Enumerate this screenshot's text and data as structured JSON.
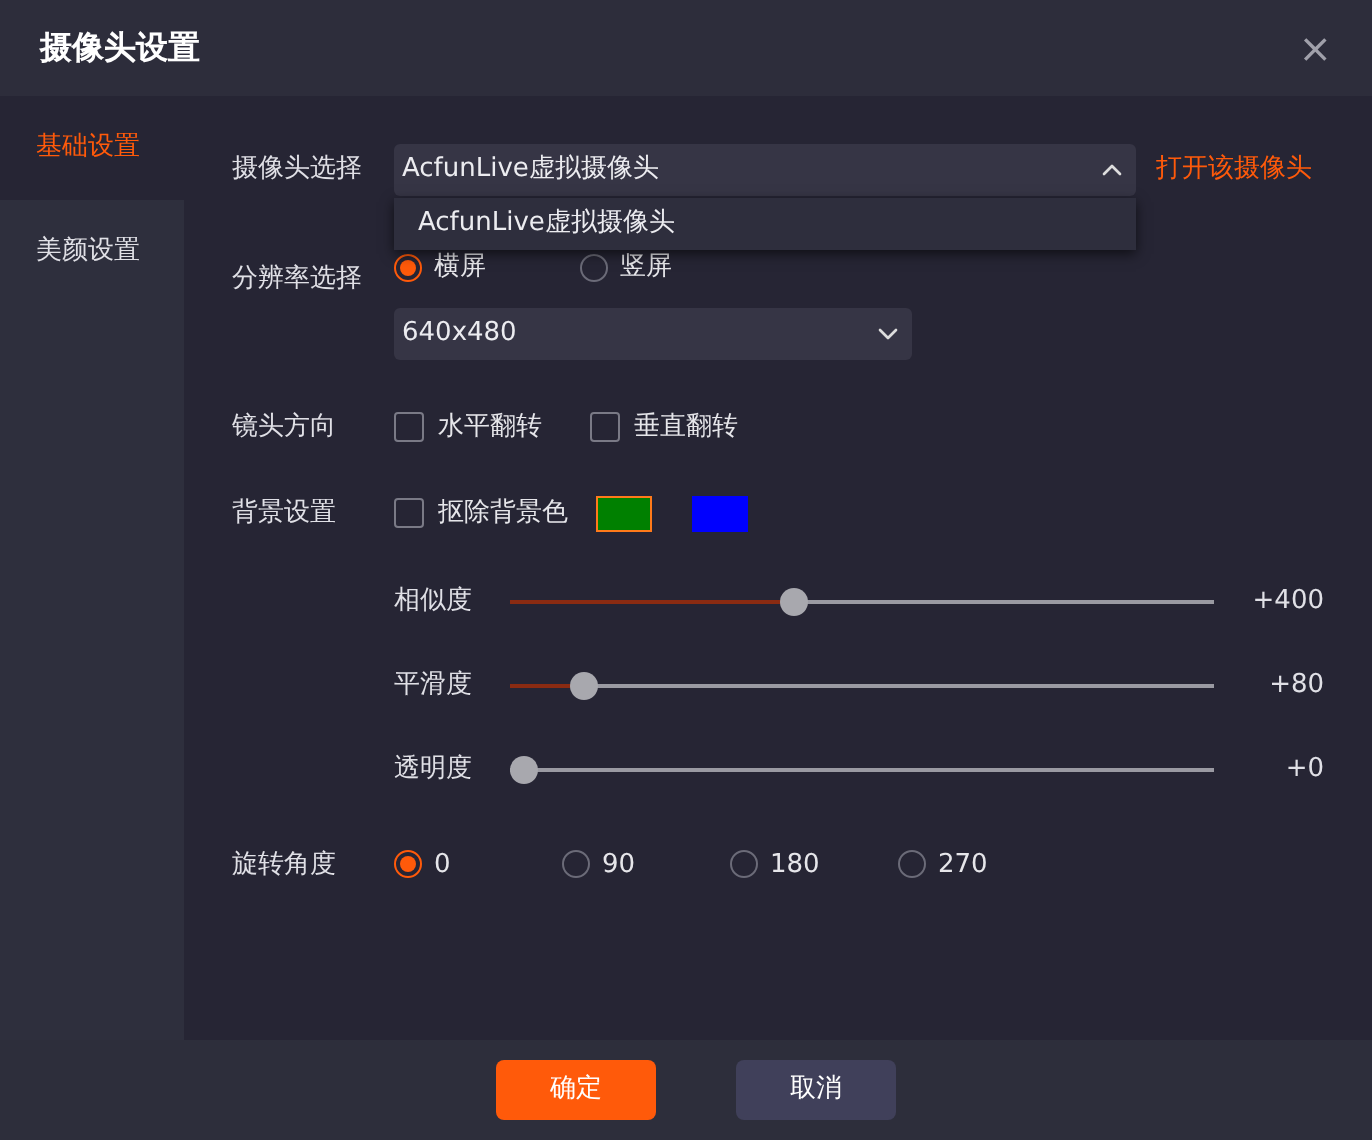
{
  "window": {
    "title": "摄像头设置",
    "close": "×"
  },
  "sidebar": {
    "items": [
      {
        "label": "基础设置",
        "selected": true
      },
      {
        "label": "美颜设置",
        "selected": false
      }
    ]
  },
  "camera": {
    "label": "摄像头选择",
    "value": "AcfunLive虚拟摄像头",
    "expanded": true,
    "options": [
      "AcfunLive虚拟摄像头"
    ],
    "link": "打开该摄像头"
  },
  "resolution": {
    "label": "分辨率选择",
    "orientations": [
      {
        "label": "横屏",
        "selected": true
      },
      {
        "label": "竖屏",
        "selected": false
      }
    ],
    "value": "640x480"
  },
  "lens": {
    "label": "镜头方向",
    "options": [
      {
        "label": "水平翻转",
        "checked": false
      },
      {
        "label": "垂直翻转",
        "checked": false
      }
    ]
  },
  "background": {
    "label": "背景设置",
    "remove": {
      "label": "抠除背景色",
      "checked": false
    },
    "swatches": [
      {
        "color": "#008000",
        "selected": true
      },
      {
        "color": "#0000ff",
        "selected": false
      }
    ],
    "sliders": [
      {
        "label": "相似度",
        "level": 0.4,
        "reading": "+400"
      },
      {
        "label": "平滑度",
        "level": 0.09,
        "reading": "+80"
      },
      {
        "label": "透明度",
        "level": 0,
        "reading": "+0"
      }
    ]
  },
  "rotation": {
    "label": "旋转角度",
    "options": [
      {
        "label": "0",
        "selected": true
      },
      {
        "label": "90",
        "selected": false
      },
      {
        "label": "180",
        "selected": false
      },
      {
        "label": "270",
        "selected": false
      }
    ]
  },
  "buttons": [
    {
      "label": "确定",
      "kind": "primary"
    },
    {
      "label": "取消",
      "kind": "secondary"
    }
  ]
}
